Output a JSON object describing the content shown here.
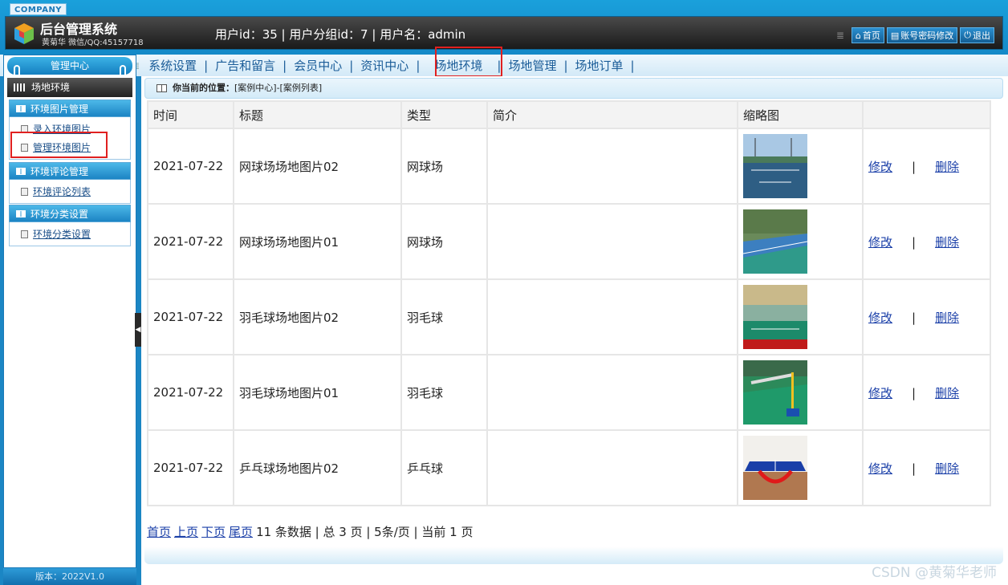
{
  "header": {
    "company_badge": "COMPANY",
    "system_title": "后台管理系统",
    "system_subtitle": "黄菊华 微信/QQ:45157718",
    "user_info": "用户id：35 | 用户分组id：7 | 用户名：admin",
    "links": [
      {
        "label": "首页",
        "icon": "home-icon"
      },
      {
        "label": "账号密码修改",
        "icon": "account-icon"
      },
      {
        "label": "退出",
        "icon": "power-icon"
      }
    ]
  },
  "nav": {
    "items": [
      "系统设置",
      "广告和留言",
      "会员中心",
      "资讯中心",
      "场地环境",
      "场地管理",
      "场地订单"
    ],
    "active": "场地环境"
  },
  "sidebar": {
    "center_label": "管理中心",
    "area_title": "场地环境",
    "groups": [
      {
        "title": "环境图片管理",
        "items": [
          "录入环境图片",
          "管理环境图片"
        ]
      },
      {
        "title": "环境评论管理",
        "items": [
          "环境评论列表"
        ]
      },
      {
        "title": "环境分类设置",
        "items": [
          "环境分类设置"
        ]
      }
    ],
    "version": "版本：2022V1.0"
  },
  "breadcrumb": {
    "label": "你当前的位置：",
    "path": "[案例中心]-[案例列表]"
  },
  "table": {
    "columns": [
      "时间",
      "标题",
      "类型",
      "简介",
      "缩略图",
      ""
    ],
    "rows": [
      {
        "date": "2021-07-22",
        "title": "网球场场地图片02",
        "type": "网球场",
        "intro": "",
        "thumb": "tennis-court-night"
      },
      {
        "date": "2021-07-22",
        "title": "网球场场地图片01",
        "type": "网球场",
        "intro": "",
        "thumb": "tennis-court-blue"
      },
      {
        "date": "2021-07-22",
        "title": "羽毛球场地图片02",
        "type": "羽毛球",
        "intro": "",
        "thumb": "badminton-hall"
      },
      {
        "date": "2021-07-22",
        "title": "羽毛球场地图片01",
        "type": "羽毛球",
        "intro": "",
        "thumb": "badminton-net"
      },
      {
        "date": "2021-07-22",
        "title": "乒乓球场地图片02",
        "type": "乒乓球",
        "intro": "",
        "thumb": "ping-pong-table"
      }
    ],
    "edit_label": "修改",
    "delete_label": "删除",
    "action_separator": "|"
  },
  "pager": {
    "first": "首页",
    "prev": "上页",
    "next": "下页",
    "last": "尾页",
    "summary": "11 条数据 | 总 3 页 | 5条/页 | 当前 1 页"
  },
  "watermark": "CSDN @黄菊华老师",
  "colors": {
    "accent": "#1489c8",
    "highlight_box": "#e02020",
    "link": "#1a3fa8"
  }
}
